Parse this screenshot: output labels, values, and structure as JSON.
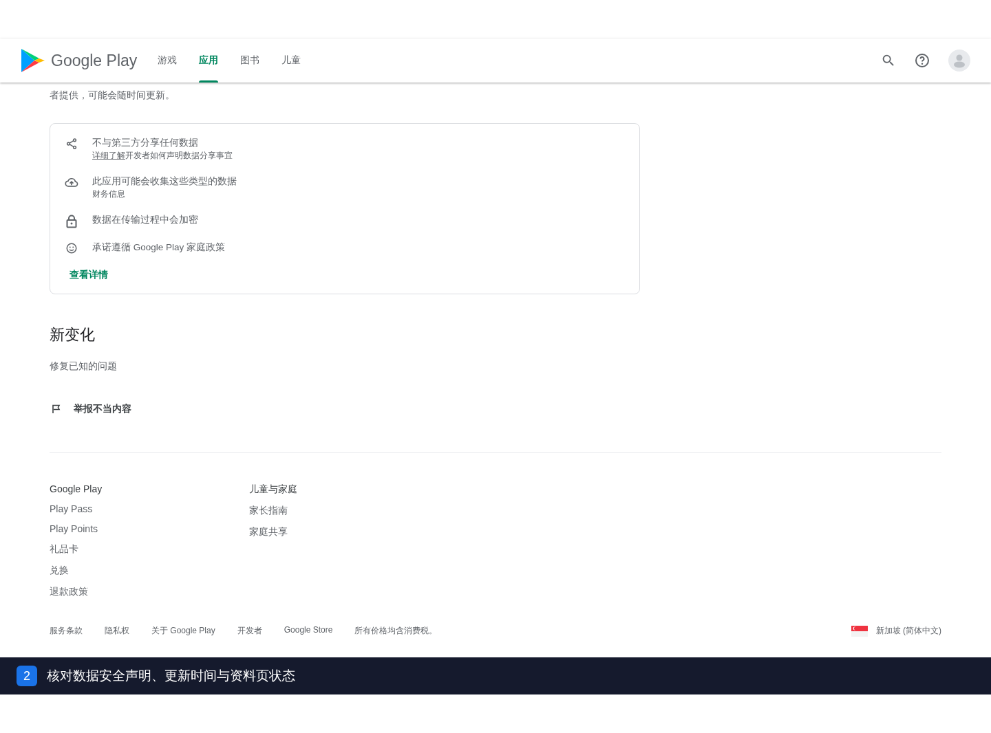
{
  "header": {
    "brand": "Google Play",
    "tabs": [
      {
        "label": "游戏",
        "selected": false
      },
      {
        "label": "应用",
        "selected": true
      },
      {
        "label": "图书",
        "selected": false
      },
      {
        "label": "儿童",
        "selected": false
      }
    ]
  },
  "intro_tail": "者提供，可能会随时间更新。",
  "safety": {
    "items": [
      {
        "kind": "share",
        "title": "不与第三方分享任何数据",
        "link": "详细了解",
        "note": "开发者如何声明数据分享事宜"
      },
      {
        "kind": "cloud",
        "title": "此应用可能会收集这些类型的数据",
        "note": "财务信息"
      },
      {
        "kind": "lock",
        "title": "数据在传输过程中会加密"
      },
      {
        "kind": "family",
        "title": "承诺遵循 Google Play 家庭政策"
      }
    ],
    "details_link": "查看详情"
  },
  "whats_new": {
    "title": "新变化",
    "text": "修复已知的问题"
  },
  "report": "举报不当内容",
  "footer": {
    "columns": [
      {
        "heading": "Google Play",
        "links": [
          "Play Pass",
          "Play Points",
          "礼品卡",
          "兑换",
          "退款政策"
        ]
      },
      {
        "heading": "儿童与家庭",
        "links": [
          "家长指南",
          "家庭共享"
        ]
      }
    ],
    "bottom_links": [
      "服务条款",
      "隐私权",
      "关于 Google Play",
      "开发者",
      "Google Store",
      "所有价格均含消费税。"
    ],
    "region": "新加坡 (简体中文)"
  },
  "caption": {
    "step": "2",
    "text": "核对数据安全声明、更新时间与资料页状态"
  }
}
